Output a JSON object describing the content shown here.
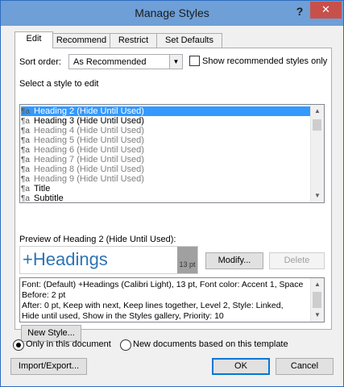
{
  "window": {
    "title": "Manage Styles",
    "help_glyph": "?",
    "close_glyph": "✕"
  },
  "tabs": [
    {
      "label": "Edit",
      "active": true
    },
    {
      "label": "Recommend",
      "active": false
    },
    {
      "label": "Restrict",
      "active": false
    },
    {
      "label": "Set Defaults",
      "active": false
    }
  ],
  "sort": {
    "label": "Sort order:",
    "value": "As Recommended",
    "show_recommended_label": "Show recommended styles only",
    "show_recommended_checked": false
  },
  "select_label": "Select a style to edit",
  "styles": [
    {
      "icon": "¶a",
      "label": "Heading 2  (Hide Until Used)",
      "selected": true,
      "grey": false
    },
    {
      "icon": "¶a",
      "label": "Heading 3  (Hide Until Used)",
      "selected": false,
      "grey": false
    },
    {
      "icon": "¶a",
      "label": "Heading 4  (Hide Until Used)",
      "selected": false,
      "grey": true
    },
    {
      "icon": "¶a",
      "label": "Heading 5  (Hide Until Used)",
      "selected": false,
      "grey": true
    },
    {
      "icon": "¶a",
      "label": "Heading 6  (Hide Until Used)",
      "selected": false,
      "grey": true
    },
    {
      "icon": "¶a",
      "label": "Heading 7  (Hide Until Used)",
      "selected": false,
      "grey": true
    },
    {
      "icon": "¶a",
      "label": "Heading 8  (Hide Until Used)",
      "selected": false,
      "grey": true
    },
    {
      "icon": "¶a",
      "label": "Heading 9  (Hide Until Used)",
      "selected": false,
      "grey": true
    },
    {
      "icon": "¶a",
      "label": "Title",
      "selected": false,
      "grey": false
    },
    {
      "icon": "¶a",
      "label": "Subtitle",
      "selected": false,
      "grey": false
    }
  ],
  "preview": {
    "label": "Preview of Heading 2  (Hide Until Used):",
    "text": "+Headings",
    "size": "13 pt"
  },
  "buttons": {
    "modify": "Modify...",
    "delete": "Delete",
    "new_style": "New Style...",
    "import_export": "Import/Export...",
    "ok": "OK",
    "cancel": "Cancel"
  },
  "description": [
    "Font: (Default) +Headings (Calibri Light), 13 pt, Font color: Accent 1, Space",
    "    Before:  2 pt",
    "    After:  0 pt, Keep with next, Keep lines together, Level 2, Style: Linked,",
    "Hide until used, Show in the Styles gallery, Priority: 10"
  ],
  "scope": {
    "only_this_document": "Only in this document",
    "new_documents": "New documents based on this template",
    "selected": "only_this_document"
  },
  "colors": {
    "titlebar": "#6e9fd6",
    "close": "#c7504b",
    "selection": "#3399ff",
    "heading_preview": "#2e74b5"
  }
}
